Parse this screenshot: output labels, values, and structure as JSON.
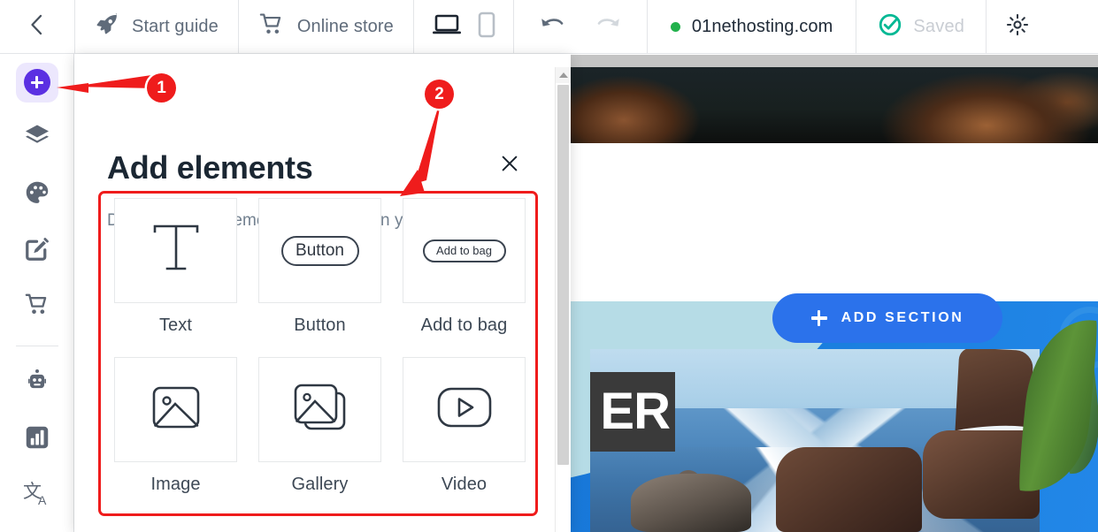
{
  "topbar": {
    "back_icon": "chevron-left-icon",
    "items": [
      {
        "label": "Start guide",
        "icon": "rocket-icon"
      },
      {
        "label": "Online store",
        "icon": "shopping-cart-icon"
      }
    ],
    "devices": [
      {
        "name": "desktop-view",
        "icon": "laptop-icon",
        "active": true
      },
      {
        "name": "mobile-view",
        "icon": "mobile-icon",
        "active": false
      }
    ],
    "undo": {
      "icon": "undo-arrow-icon",
      "enabled": true
    },
    "redo": {
      "icon": "redo-arrow-icon",
      "enabled": false
    },
    "domain": "01nethosting.com",
    "domain_status_color": "#22b14c",
    "saved_label": "Saved",
    "saved_color": "#00b894",
    "settings_icon": "gear-icon"
  },
  "rail": {
    "items": [
      {
        "name": "add-elements",
        "icon": "plus-circle-icon",
        "active": true
      },
      {
        "name": "layers",
        "icon": "layers-icon",
        "active": false
      },
      {
        "name": "design",
        "icon": "palette-icon",
        "active": false
      },
      {
        "name": "edit-content",
        "icon": "pencil-square-icon",
        "active": false
      },
      {
        "name": "store",
        "icon": "shopping-cart-icon",
        "active": false
      },
      {
        "name": "assistant",
        "icon": "robot-icon",
        "active": false
      },
      {
        "name": "analytics",
        "icon": "bar-chart-icon",
        "active": false
      },
      {
        "name": "translate",
        "icon": "translate-icon",
        "active": false
      }
    ],
    "accent_color": "#5b30e2",
    "active_bg": "#ece7fd"
  },
  "panel": {
    "title": "Add elements",
    "subtitle": "Drag and drop elements anywhere on your page",
    "close_icon": "close-x-icon",
    "elements": [
      {
        "label": "Text",
        "icon": "text-t-icon"
      },
      {
        "label": "Button",
        "icon": "button-pill-icon",
        "pill_text": "Button"
      },
      {
        "label": "Add to bag",
        "icon": "add-to-bag-pill-icon",
        "pill_text": "Add to bag"
      },
      {
        "label": "Image",
        "icon": "image-icon"
      },
      {
        "label": "Gallery",
        "icon": "gallery-icon"
      },
      {
        "label": "Video",
        "icon": "video-play-icon"
      }
    ]
  },
  "canvas": {
    "add_section_label": "ADD SECTION",
    "add_section_color": "#2b72eb",
    "hero_badge_text": "ER",
    "scroll_up_icon": "scroll-up-arrow-icon"
  },
  "annotations": {
    "color": "#ef1c1c",
    "markers": [
      {
        "number": "1",
        "points_to": "add-elements-rail-button"
      },
      {
        "number": "2",
        "points_to": "elements-grid"
      }
    ],
    "highlight_box": "elements-grid"
  }
}
